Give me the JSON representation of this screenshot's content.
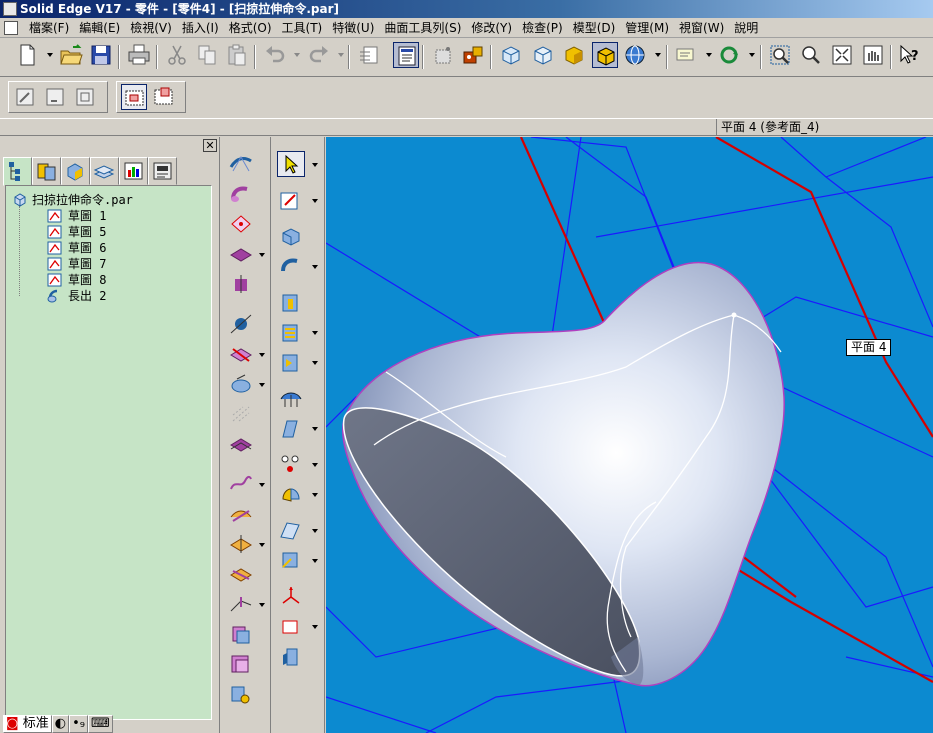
{
  "window": {
    "title": "Solid Edge V17 - 零件 - [零件4] - [扫掠拉伸命令.par]"
  },
  "menu": [
    "檔案(F)",
    "編輯(E)",
    "檢視(V)",
    "插入(I)",
    "格式(O)",
    "工具(T)",
    "特徵(U)",
    "曲面工具列(S)",
    "修改(Y)",
    "檢查(P)",
    "模型(D)",
    "管理(M)",
    "視窗(W)",
    "說明"
  ],
  "status": {
    "prompt": "平面 4 (參考面_4)"
  },
  "tree": {
    "root": "扫掠拉伸命令.par",
    "items": [
      {
        "label": "草圖 1",
        "icon": "sketch-icon"
      },
      {
        "label": "草圖 5",
        "icon": "sketch-icon"
      },
      {
        "label": "草圖 6",
        "icon": "sketch-icon"
      },
      {
        "label": "草圖 7",
        "icon": "sketch-icon"
      },
      {
        "label": "草圖 8",
        "icon": "sketch-icon"
      },
      {
        "label": "長出 2",
        "icon": "extrude-feature-icon"
      }
    ]
  },
  "bottom_tabs": [
    "标准"
  ],
  "viewport": {
    "tooltip": "平面 4",
    "background": "#0c8ad0",
    "plane_color": "#1a1aff",
    "highlight_color": "#d40000"
  }
}
